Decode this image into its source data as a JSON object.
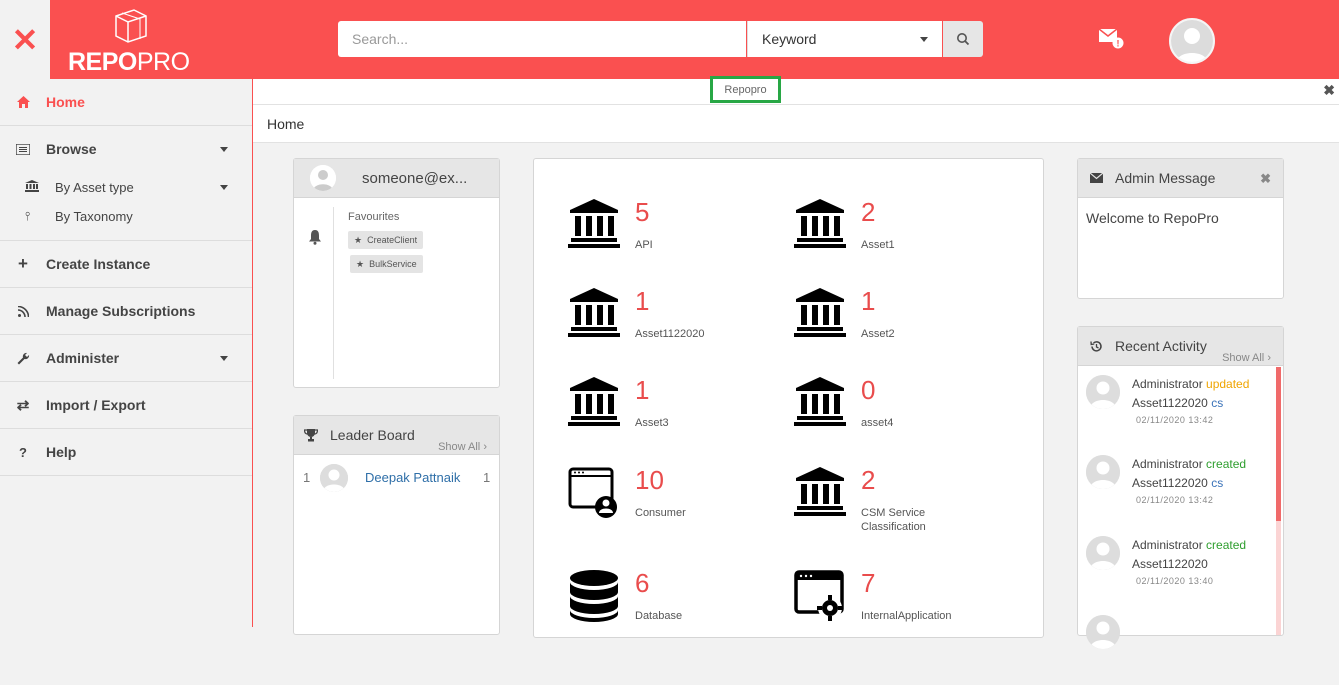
{
  "brand": {
    "logo_bold": "REPO",
    "logo_light": "PRO"
  },
  "header": {
    "close_glyph": "✕",
    "search_placeholder": "Search...",
    "search_type": "Keyword",
    "search_icon": "search-icon",
    "mail_icon": "mail-alert-icon",
    "avatar_icon": "user-avatar"
  },
  "sidebar": {
    "items": [
      {
        "label": "Home",
        "icon": "home-icon",
        "active": true
      },
      {
        "label": "Browse",
        "icon": "list-icon"
      },
      {
        "label": "By Asset type",
        "icon": "bank-icon"
      },
      {
        "label": "By Taxonomy",
        "icon": "taxonomy-icon"
      },
      {
        "label": "Create Instance",
        "icon": "plus-icon"
      },
      {
        "label": "Manage Subscriptions",
        "icon": "rss-icon"
      },
      {
        "label": "Administer",
        "icon": "wrench-icon"
      },
      {
        "label": "Import / Export",
        "icon": "exchange-icon"
      },
      {
        "label": "Help",
        "icon": "question-icon"
      }
    ]
  },
  "tabs": {
    "active": "Repopro",
    "close": "✖"
  },
  "breadcrumb": "Home",
  "user_panel": {
    "email": "someone@ex...",
    "favourites_title": "Favourites",
    "favourites": [
      "CreateClient",
      "BulkService"
    ]
  },
  "leader_board": {
    "title": "Leader Board",
    "show_all": "Show All",
    "rows": [
      {
        "rank": "1",
        "name": "Deepak Pattnaik",
        "score": "1"
      }
    ]
  },
  "stats": [
    {
      "value": "5",
      "label": "API",
      "icon": "bank-icon"
    },
    {
      "value": "2",
      "label": "Asset1",
      "icon": "bank-icon"
    },
    {
      "value": "1",
      "label": "Asset1122020",
      "icon": "bank-icon"
    },
    {
      "value": "1",
      "label": "Asset2",
      "icon": "bank-icon"
    },
    {
      "value": "1",
      "label": "Asset3",
      "icon": "bank-icon"
    },
    {
      "value": "0",
      "label": "asset4",
      "icon": "bank-icon"
    },
    {
      "value": "10",
      "label": "Consumer",
      "icon": "consumer-window-icon"
    },
    {
      "value": "2",
      "label": "CSM Service Classification",
      "icon": "bank-icon"
    },
    {
      "value": "6",
      "label": "Database",
      "icon": "database-icon"
    },
    {
      "value": "7",
      "label": "InternalApplication",
      "icon": "app-settings-icon"
    }
  ],
  "admin_message": {
    "title": "Admin Message",
    "body": "Welcome to RepoPro"
  },
  "recent_activity": {
    "title": "Recent Activity",
    "show_all": "Show All",
    "items": [
      {
        "user": "Administrator",
        "action": "updated",
        "asset": "Asset1122020",
        "suffix": "cs",
        "time": "02/11/2020 13:42"
      },
      {
        "user": "Administrator",
        "action": "created",
        "asset": "Asset1122020",
        "suffix": "cs",
        "time": "02/11/2020 13:42"
      },
      {
        "user": "Administrator",
        "action": "created",
        "asset": "Asset1122020",
        "suffix": "",
        "time": "02/11/2020 13:40"
      }
    ]
  },
  "colors": {
    "brand_red": "#fa5050",
    "stat_red": "#e94c4c",
    "updated": "#f0a500",
    "created": "#2e9e2e",
    "link": "#3b73b9"
  }
}
